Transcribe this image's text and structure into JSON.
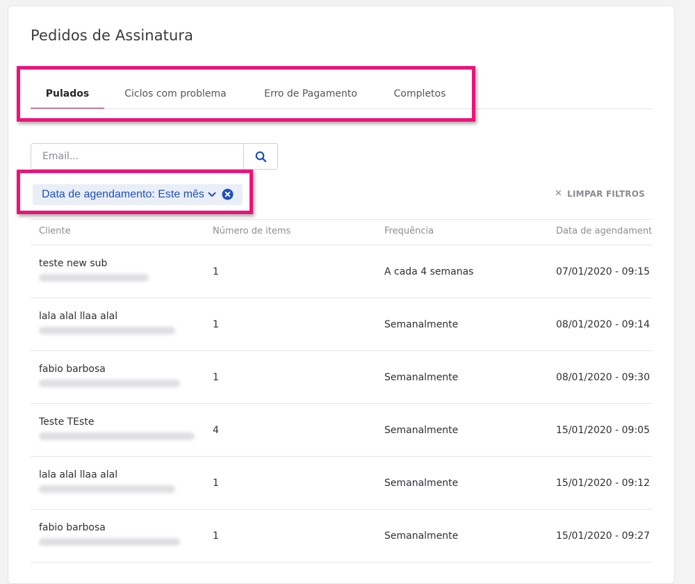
{
  "page": {
    "title": "Pedidos de Assinatura"
  },
  "tabs": [
    {
      "label": "Pulados",
      "active": true
    },
    {
      "label": "Ciclos com problema",
      "active": false
    },
    {
      "label": "Erro de Pagamento",
      "active": false
    },
    {
      "label": "Completos",
      "active": false
    }
  ],
  "search": {
    "placeholder": "Email...",
    "value": "",
    "button_icon": "search-icon"
  },
  "filters": {
    "chip_label": "Data de agendamento: Este mês",
    "chip_chevron_icon": "chevron-down-icon",
    "chip_clear_icon": "close-circle-icon",
    "clear_all_label": "LIMPAR FILTROS",
    "clear_all_icon": "close-icon"
  },
  "table": {
    "columns": [
      "Cliente",
      "Número de items",
      "Frequência",
      "Data de agendamento"
    ],
    "rows": [
      {
        "cliente": "teste new sub",
        "items": "1",
        "frequencia": "A cada 4 semanas",
        "data": "07/01/2020 - 09:15"
      },
      {
        "cliente": "lala alal llaa alal",
        "items": "1",
        "frequencia": "Semanalmente",
        "data": "08/01/2020 - 09:14"
      },
      {
        "cliente": "fabio barbosa",
        "items": "1",
        "frequencia": "Semanalmente",
        "data": "08/01/2020 - 09:30"
      },
      {
        "cliente": "Teste TEste",
        "items": "4",
        "frequencia": "Semanalmente",
        "data": "15/01/2020 - 09:05"
      },
      {
        "cliente": "lala alal llaa alal",
        "items": "1",
        "frequencia": "Semanalmente",
        "data": "15/01/2020 - 09:12"
      },
      {
        "cliente": "fabio barbosa",
        "items": "1",
        "frequencia": "Semanalmente",
        "data": "15/01/2020 - 09:27"
      }
    ]
  },
  "colors": {
    "accent_tab_underline": "#b7124f",
    "annotation_highlight": "#ec1278",
    "chip_text": "#1f4fbf",
    "chip_background": "#e9eef7"
  }
}
